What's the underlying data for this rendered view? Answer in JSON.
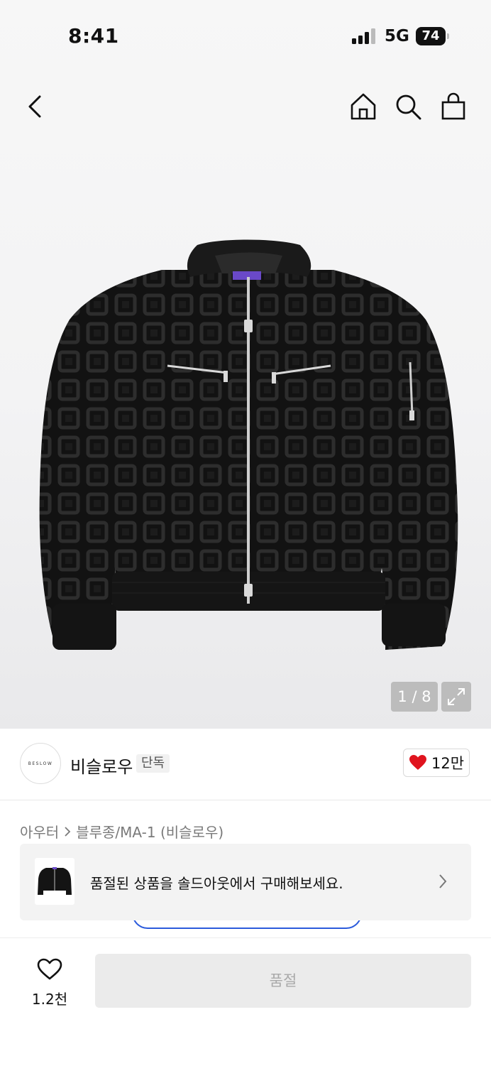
{
  "status_bar": {
    "time": "8:41",
    "network": "5G",
    "battery": "74"
  },
  "header": {
    "back_icon": "chevron-left-icon",
    "home_icon": "home-icon",
    "search_icon": "search-icon",
    "cart_icon": "shopping-bag-icon"
  },
  "gallery": {
    "counter": "1 / 8",
    "expand_icon": "expand-icon"
  },
  "brand": {
    "logo_text": "BESLOW",
    "name": "비슬로우",
    "badge": "단독",
    "likes": "12만"
  },
  "breadcrumb": {
    "category": "아우터",
    "subcategory": "블루종/MA-1 (비슬로우)"
  },
  "soldout_banner": {
    "text": "품절된 상품을 솔드아웃에서 구매해보세요."
  },
  "bottom_bar": {
    "wish_count": "1.2천",
    "buy_label": "품절"
  },
  "colors": {
    "accent_heart": "#e0141e",
    "arc_blue": "#2b5bdc",
    "disabled_button": "#ebebeb"
  }
}
